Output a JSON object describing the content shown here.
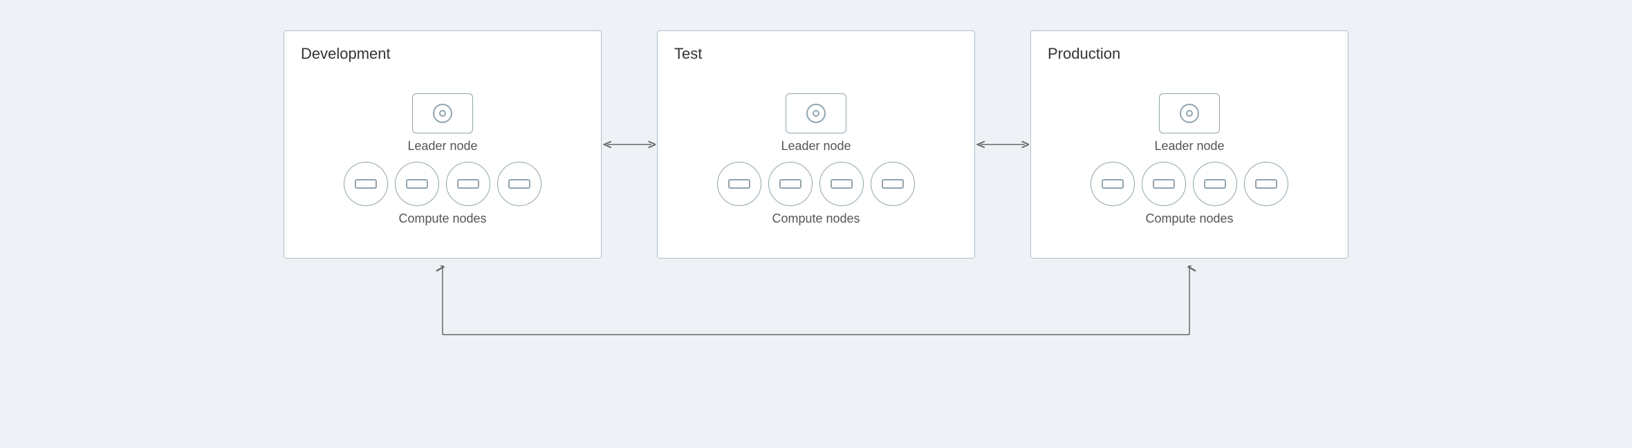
{
  "environments": [
    {
      "id": "development",
      "title": "Development",
      "leader_label": "Leader node",
      "compute_label": "Compute nodes",
      "compute_count": 4
    },
    {
      "id": "test",
      "title": "Test",
      "leader_label": "Leader node",
      "compute_label": "Compute nodes",
      "compute_count": 4
    },
    {
      "id": "production",
      "title": "Production",
      "leader_label": "Leader node",
      "compute_label": "Compute nodes",
      "compute_count": 4
    }
  ],
  "arrows": {
    "horizontal_left_right": "↔",
    "up_arrow": "↑"
  },
  "colors": {
    "border": "#b0bec5",
    "icon_stroke": "#90a4ae",
    "text": "#555",
    "title": "#333",
    "background": "#eef2f7",
    "box_bg": "#ffffff"
  }
}
